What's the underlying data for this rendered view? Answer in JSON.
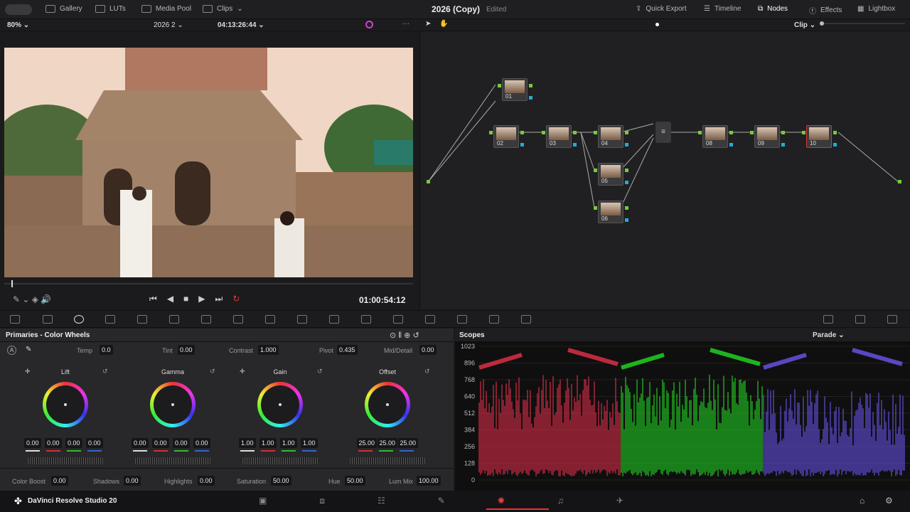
{
  "topbar": {
    "gallery": "Gallery",
    "luts": "LUTs",
    "media_pool": "Media Pool",
    "clips": "Clips",
    "project": "2026 (Copy)",
    "status": "Edited",
    "quick_export": "Quick Export",
    "timeline": "Timeline",
    "nodes": "Nodes",
    "effects": "Effects",
    "lightbox": "Lightbox"
  },
  "viewer": {
    "zoom": "80%",
    "clip_name": "2026 2",
    "timecode": "04:13:26:44",
    "playhead_tc": "01:00:54:12",
    "mode": "Clip"
  },
  "nodes": [
    "01",
    "02",
    "03",
    "04",
    "05",
    "06",
    "08",
    "09",
    "10"
  ],
  "panel": {
    "title": "Primaries - Color Wheels",
    "temp_label": "Temp",
    "temp": "0.0",
    "tint_label": "Tint",
    "tint": "0.00",
    "contrast_label": "Contrast",
    "contrast": "1.000",
    "pivot_label": "Pivot",
    "pivot": "0.435",
    "mid_label": "Mid/Detail",
    "mid": "0.00",
    "wheels": [
      {
        "name": "Lift",
        "values": [
          "0.00",
          "0.00",
          "0.00",
          "0.00"
        ]
      },
      {
        "name": "Gamma",
        "values": [
          "0.00",
          "0.00",
          "0.00",
          "0.00"
        ]
      },
      {
        "name": "Gain",
        "values": [
          "1.00",
          "1.00",
          "1.00",
          "1.00"
        ]
      },
      {
        "name": "Offset",
        "values": [
          "25.00",
          "25.00",
          "25.00"
        ]
      }
    ],
    "cb_label": "Color Boost",
    "cb": "0.00",
    "sh_label": "Shadows",
    "sh": "0.00",
    "hl_label": "Highlights",
    "hl": "0.00",
    "sat_label": "Saturation",
    "sat": "50.00",
    "hue_label": "Hue",
    "hue": "50.00",
    "lm_label": "Lum Mix",
    "lm": "100.00"
  },
  "scopes": {
    "title": "Scopes",
    "mode": "Parade",
    "ticks": [
      "1023",
      "896",
      "768",
      "640",
      "512",
      "384",
      "256",
      "128",
      "0"
    ]
  },
  "bottom": {
    "app": "DaVinci Resolve Studio 20"
  },
  "colors": {
    "accent": "#e23b3b",
    "node_green": "#77cc33",
    "node_blue": "#22aadd"
  }
}
